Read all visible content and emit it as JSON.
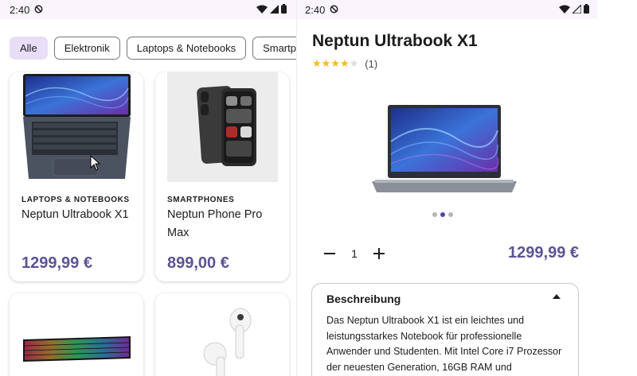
{
  "status_bar": {
    "time": "2:40"
  },
  "filters": [
    "Alle",
    "Elektronik",
    "Laptops & Notebooks",
    "Smartphones"
  ],
  "products": [
    {
      "category": "LAPTOPS & NOTEBOOKS",
      "name": "Neptun Ultrabook X1",
      "price": "1299,99 €"
    },
    {
      "category": "SMARTPHONES",
      "name": "Neptun Phone Pro Max",
      "price": "899,00 €"
    }
  ],
  "detail": {
    "title": "Neptun Ultrabook X1",
    "rating_value": 4,
    "rating_max": 5,
    "rating_count": "(1)",
    "quantity": "1",
    "price": "1299,99 €",
    "image_count": 3,
    "active_image": 2,
    "description_title": "Beschreibung",
    "description_text": "Das Neptun Ultrabook X1 ist ein leichtes und leistungsstarkes Notebook für professionelle Anwender und Studenten. Mit Intel Core i7 Prozessor der neuesten Generation, 16GB RAM und"
  },
  "colors": {
    "accent": "#5b5493",
    "chip_active": "#e8def8",
    "star": "#f7b924",
    "dot_active": "#5b3fae"
  },
  "icons": [
    "do-not-disturb-icon",
    "wifi-icon",
    "cell-signal-icon",
    "battery-icon",
    "minus-icon",
    "plus-icon",
    "collapse-arrow-icon"
  ]
}
